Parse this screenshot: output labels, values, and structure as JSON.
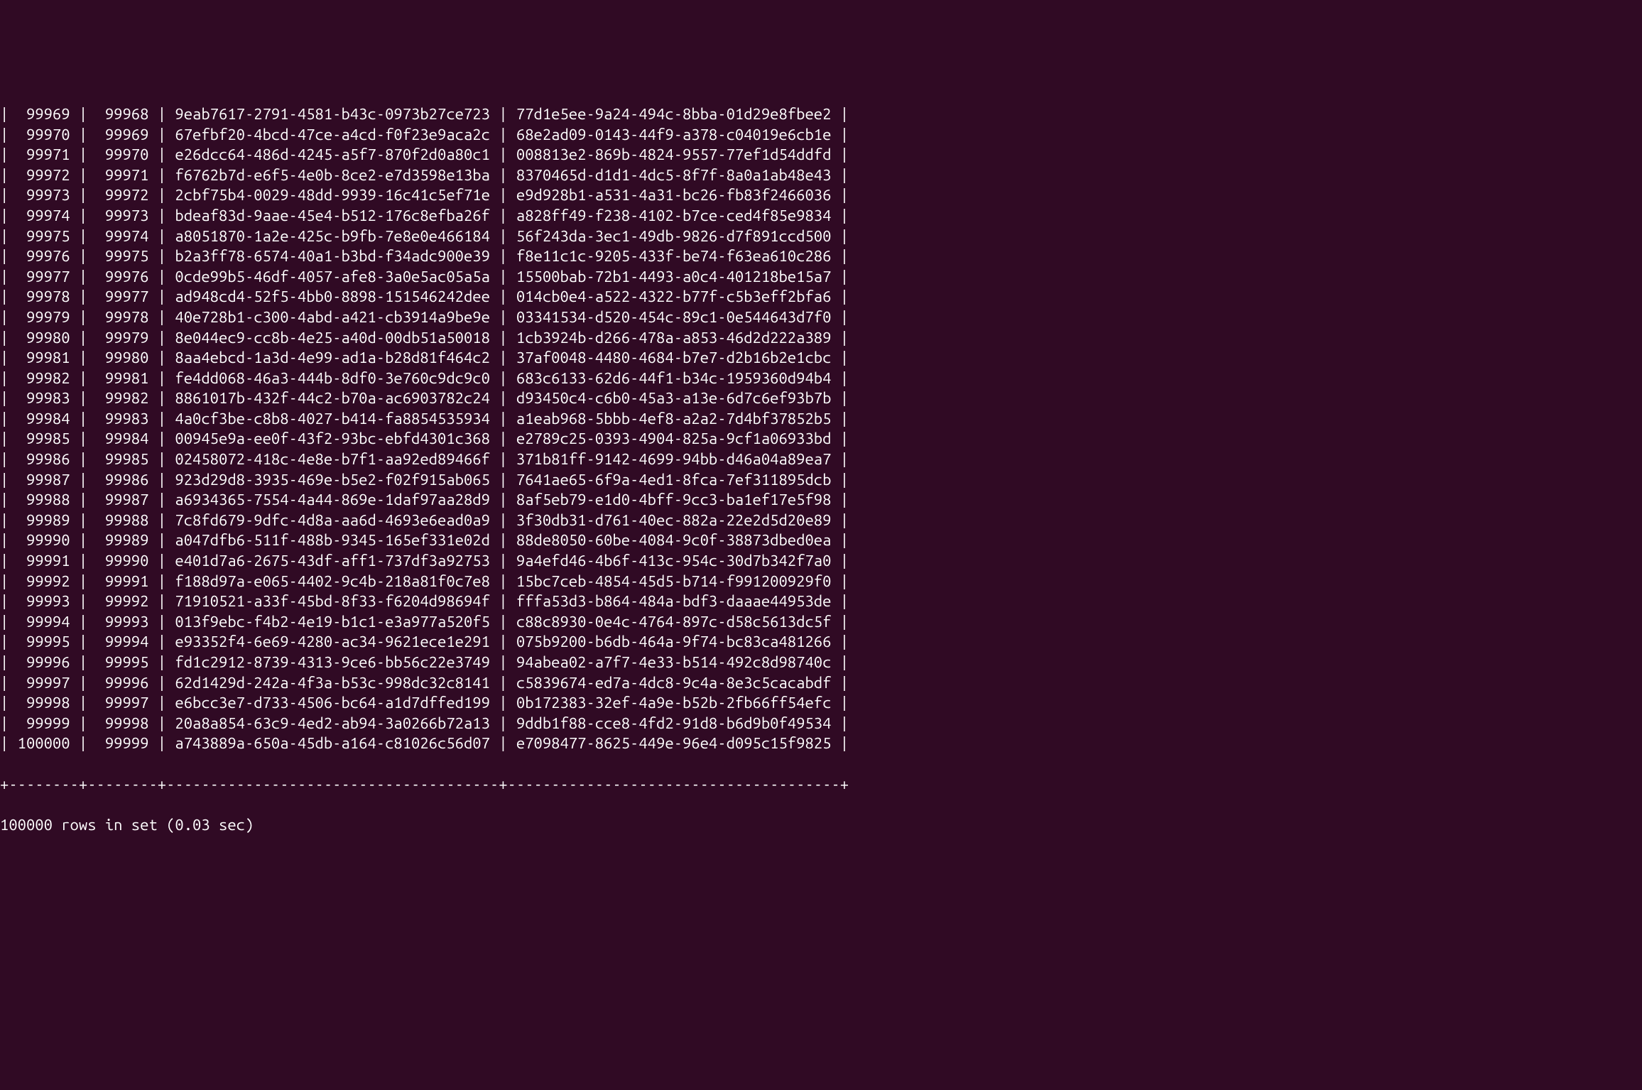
{
  "rows": [
    {
      "col1": "99969",
      "col2": "99968",
      "uuid1": "9eab7617-2791-4581-b43c-0973b27ce723",
      "uuid2": "77d1e5ee-9a24-494c-8bba-01d29e8fbee2"
    },
    {
      "col1": "99970",
      "col2": "99969",
      "uuid1": "67efbf20-4bcd-47ce-a4cd-f0f23e9aca2c",
      "uuid2": "68e2ad09-0143-44f9-a378-c04019e6cb1e"
    },
    {
      "col1": "99971",
      "col2": "99970",
      "uuid1": "e26dcc64-486d-4245-a5f7-870f2d0a80c1",
      "uuid2": "008813e2-869b-4824-9557-77ef1d54ddfd"
    },
    {
      "col1": "99972",
      "col2": "99971",
      "uuid1": "f6762b7d-e6f5-4e0b-8ce2-e7d3598e13ba",
      "uuid2": "8370465d-d1d1-4dc5-8f7f-8a0a1ab48e43"
    },
    {
      "col1": "99973",
      "col2": "99972",
      "uuid1": "2cbf75b4-0029-48dd-9939-16c41c5ef71e",
      "uuid2": "e9d928b1-a531-4a31-bc26-fb83f2466036"
    },
    {
      "col1": "99974",
      "col2": "99973",
      "uuid1": "bdeaf83d-9aae-45e4-b512-176c8efba26f",
      "uuid2": "a828ff49-f238-4102-b7ce-ced4f85e9834"
    },
    {
      "col1": "99975",
      "col2": "99974",
      "uuid1": "a8051870-1a2e-425c-b9fb-7e8e0e466184",
      "uuid2": "56f243da-3ec1-49db-9826-d7f891ccd500"
    },
    {
      "col1": "99976",
      "col2": "99975",
      "uuid1": "b2a3ff78-6574-40a1-b3bd-f34adc900e39",
      "uuid2": "f8e11c1c-9205-433f-be74-f63ea610c286"
    },
    {
      "col1": "99977",
      "col2": "99976",
      "uuid1": "0cde99b5-46df-4057-afe8-3a0e5ac05a5a",
      "uuid2": "15500bab-72b1-4493-a0c4-401218be15a7"
    },
    {
      "col1": "99978",
      "col2": "99977",
      "uuid1": "ad948cd4-52f5-4bb0-8898-151546242dee",
      "uuid2": "014cb0e4-a522-4322-b77f-c5b3eff2bfa6"
    },
    {
      "col1": "99979",
      "col2": "99978",
      "uuid1": "40e728b1-c300-4abd-a421-cb3914a9be9e",
      "uuid2": "03341534-d520-454c-89c1-0e544643d7f0"
    },
    {
      "col1": "99980",
      "col2": "99979",
      "uuid1": "8e044ec9-cc8b-4e25-a40d-00db51a50018",
      "uuid2": "1cb3924b-d266-478a-a853-46d2d222a389"
    },
    {
      "col1": "99981",
      "col2": "99980",
      "uuid1": "8aa4ebcd-1a3d-4e99-ad1a-b28d81f464c2",
      "uuid2": "37af0048-4480-4684-b7e7-d2b16b2e1cbc"
    },
    {
      "col1": "99982",
      "col2": "99981",
      "uuid1": "fe4dd068-46a3-444b-8df0-3e760c9dc9c0",
      "uuid2": "683c6133-62d6-44f1-b34c-1959360d94b4"
    },
    {
      "col1": "99983",
      "col2": "99982",
      "uuid1": "8861017b-432f-44c2-b70a-ac6903782c24",
      "uuid2": "d93450c4-c6b0-45a3-a13e-6d7c6ef93b7b"
    },
    {
      "col1": "99984",
      "col2": "99983",
      "uuid1": "4a0cf3be-c8b8-4027-b414-fa8854535934",
      "uuid2": "a1eab968-5bbb-4ef8-a2a2-7d4bf37852b5"
    },
    {
      "col1": "99985",
      "col2": "99984",
      "uuid1": "00945e9a-ee0f-43f2-93bc-ebfd4301c368",
      "uuid2": "e2789c25-0393-4904-825a-9cf1a06933bd"
    },
    {
      "col1": "99986",
      "col2": "99985",
      "uuid1": "02458072-418c-4e8e-b7f1-aa92ed89466f",
      "uuid2": "371b81ff-9142-4699-94bb-d46a04a89ea7"
    },
    {
      "col1": "99987",
      "col2": "99986",
      "uuid1": "923d29d8-3935-469e-b5e2-f02f915ab065",
      "uuid2": "7641ae65-6f9a-4ed1-8fca-7ef311895dcb"
    },
    {
      "col1": "99988",
      "col2": "99987",
      "uuid1": "a6934365-7554-4a44-869e-1daf97aa28d9",
      "uuid2": "8af5eb79-e1d0-4bff-9cc3-ba1ef17e5f98"
    },
    {
      "col1": "99989",
      "col2": "99988",
      "uuid1": "7c8fd679-9dfc-4d8a-aa6d-4693e6ead0a9",
      "uuid2": "3f30db31-d761-40ec-882a-22e2d5d20e89"
    },
    {
      "col1": "99990",
      "col2": "99989",
      "uuid1": "a047dfb6-511f-488b-9345-165ef331e02d",
      "uuid2": "88de8050-60be-4084-9c0f-38873dbed0ea"
    },
    {
      "col1": "99991",
      "col2": "99990",
      "uuid1": "e401d7a6-2675-43df-aff1-737df3a92753",
      "uuid2": "9a4efd46-4b6f-413c-954c-30d7b342f7a0"
    },
    {
      "col1": "99992",
      "col2": "99991",
      "uuid1": "f188d97a-e065-4402-9c4b-218a81f0c7e8",
      "uuid2": "15bc7ceb-4854-45d5-b714-f991200929f0"
    },
    {
      "col1": "99993",
      "col2": "99992",
      "uuid1": "71910521-a33f-45bd-8f33-f6204d98694f",
      "uuid2": "fffa53d3-b864-484a-bdf3-daaae44953de"
    },
    {
      "col1": "99994",
      "col2": "99993",
      "uuid1": "013f9ebc-f4b2-4e19-b1c1-e3a977a520f5",
      "uuid2": "c88c8930-0e4c-4764-897c-d58c5613dc5f"
    },
    {
      "col1": "99995",
      "col2": "99994",
      "uuid1": "e93352f4-6e69-4280-ac34-9621ece1e291",
      "uuid2": "075b9200-b6db-464a-9f74-bc83ca481266"
    },
    {
      "col1": "99996",
      "col2": "99995",
      "uuid1": "fd1c2912-8739-4313-9ce6-bb56c22e3749",
      "uuid2": "94abea02-a7f7-4e33-b514-492c8d98740c"
    },
    {
      "col1": "99997",
      "col2": "99996",
      "uuid1": "62d1429d-242a-4f3a-b53c-998dc32c8141",
      "uuid2": "c5839674-ed7a-4dc8-9c4a-8e3c5cacabdf"
    },
    {
      "col1": "99998",
      "col2": "99997",
      "uuid1": "e6bcc3e7-d733-4506-bc64-a1d7dffed199",
      "uuid2": "0b172383-32ef-4a9e-b52b-2fb66ff54efc"
    },
    {
      "col1": "99999",
      "col2": "99998",
      "uuid1": "20a8a854-63c9-4ed2-ab94-3a0266b72a13",
      "uuid2": "9ddb1f88-cce8-4fd2-91d8-b6d9b0f49534"
    },
    {
      "col1": "100000",
      "col2": "99999",
      "uuid1": "a743889a-650a-45db-a164-c81026c56d07",
      "uuid2": "e7098477-8625-449e-96e4-d095c15f9825"
    }
  ],
  "separator": "+--------+--------+--------------------------------------+--------------------------------------+",
  "footer": "100000 rows in set (0.03 sec)",
  "blank": ""
}
